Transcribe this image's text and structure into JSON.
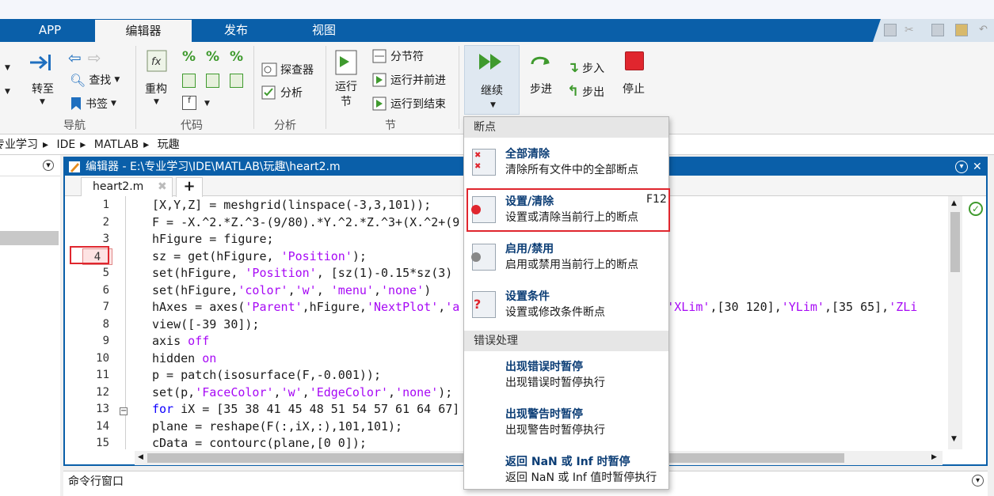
{
  "tabs": [
    "APP",
    "编辑器",
    "发布",
    "视图"
  ],
  "ribbon": {
    "nav": {
      "goto": "转至",
      "find": "查找",
      "bookmark": "书签",
      "group": "导航"
    },
    "code": {
      "refactor": "重构",
      "group": "代码"
    },
    "analyze": {
      "explorer": "探查器",
      "analyze": "分析",
      "group": "分析"
    },
    "section": {
      "run_section": "运行\n节",
      "section_break": "分节符",
      "run_and_advance": "运行并前进",
      "run_to_end": "运行到结束",
      "group": "节"
    },
    "debug": {
      "continue": "继续",
      "step": "步进",
      "step_in": "步入",
      "step_out": "步出",
      "stop": "停止"
    },
    "icons": {
      "percent": "%",
      "fx": "fx"
    }
  },
  "breadcrumb": [
    "专业学习",
    "IDE",
    "MATLAB",
    "玩趣"
  ],
  "editor": {
    "title": "编辑器 - E:\\专业学习\\IDE\\MATLAB\\玩趣\\heart2.m",
    "file_tab": "heart2.m",
    "add_tab": "+",
    "line_numbers": [
      "1",
      "2",
      "3",
      "4",
      "5",
      "6",
      "7",
      "8",
      "9",
      "10",
      "11",
      "12",
      "13",
      "14",
      "15"
    ],
    "code_lines": [
      [
        [
          "[X,Y,Z] = meshgrid(linspace(-3,3,101));",
          ""
        ]
      ],
      [
        [
          "F = -X.^2.*Z.^3-(9/80).*Y.^2.*Z.^3+(X.^2+(9",
          ""
        ]
      ],
      [
        [
          "hFigure = figure;",
          ""
        ]
      ],
      [
        [
          "sz = get(hFigure, ",
          ""
        ],
        [
          "'Position'",
          "s"
        ],
        [
          ");",
          ""
        ]
      ],
      [
        [
          "set(hFigure, ",
          ""
        ],
        [
          "'Position'",
          "s"
        ],
        [
          ", [sz(1)-0.15*sz(3)",
          ""
        ]
      ],
      [
        [
          "set(hFigure,",
          ""
        ],
        [
          "'color'",
          "s"
        ],
        [
          ",",
          ""
        ],
        [
          "'w'",
          "s"
        ],
        [
          ", ",
          ""
        ],
        [
          "'menu'",
          "s"
        ],
        [
          ",",
          ""
        ],
        [
          "'none'",
          "s"
        ],
        [
          ")",
          ""
        ]
      ],
      [
        [
          "hAxes = axes(",
          ""
        ],
        [
          "'Parent'",
          "s"
        ],
        [
          ",hFigure,",
          ""
        ],
        [
          "'NextPlot'",
          "s"
        ],
        [
          ",",
          ""
        ],
        [
          "'a",
          "s"
        ],
        [
          "                         1], ",
          ""
        ],
        [
          "'XLim'",
          "s"
        ],
        [
          ",[30 120],",
          ""
        ],
        [
          "'YLim'",
          "s"
        ],
        [
          ",[35 65],",
          ""
        ],
        [
          "'ZLi",
          "s"
        ]
      ],
      [
        [
          "view([-39 30]);",
          ""
        ]
      ],
      [
        [
          "axis ",
          ""
        ],
        [
          "off",
          "s"
        ]
      ],
      [
        [
          "hidden ",
          ""
        ],
        [
          "on",
          "s"
        ]
      ],
      [
        [
          "p = patch(isosurface(F,-0.001));",
          ""
        ]
      ],
      [
        [
          "set(p,",
          ""
        ],
        [
          "'FaceColor'",
          "s"
        ],
        [
          ",",
          ""
        ],
        [
          "'w'",
          "s"
        ],
        [
          ",",
          ""
        ],
        [
          "'EdgeColor'",
          "s"
        ],
        [
          ",",
          ""
        ],
        [
          "'none'",
          "s"
        ],
        [
          ");",
          ""
        ]
      ],
      [
        [
          "for",
          "k"
        ],
        [
          " iX = [35 38 41 45 48 51 54 57 61 64 67]",
          ""
        ]
      ],
      [
        [
          "plane = reshape(F(:,iX,:),101,101);",
          ""
        ]
      ],
      [
        [
          "cData = contourc(plane,[0 0]);",
          ""
        ]
      ]
    ],
    "breakpoint_line": "4"
  },
  "command_window": {
    "title": "命令行窗口"
  },
  "menu": {
    "header_breakpoints": "断点",
    "items": [
      {
        "title": "全部清除",
        "desc": "清除所有文件中的全部断点",
        "shortcut": ""
      },
      {
        "title": "设置/清除",
        "desc": "设置或清除当前行上的断点",
        "shortcut": "F12"
      },
      {
        "title": "启用/禁用",
        "desc": "启用或禁用当前行上的断点",
        "shortcut": ""
      },
      {
        "title": "设置条件",
        "desc": "设置或修改条件断点",
        "shortcut": ""
      }
    ],
    "header_errors": "错误处理",
    "error_items": [
      {
        "title": "出现错误时暂停",
        "desc": "出现错误时暂停执行"
      },
      {
        "title": "出现警告时暂停",
        "desc": "出现警告时暂停执行"
      },
      {
        "title": "返回 NaN 或 Inf 时暂停",
        "desc": "返回 NaN 或 Inf 值时暂停执行"
      }
    ]
  },
  "colors": {
    "accent": "#0a5fa9",
    "highlight": "#e0262e",
    "string": "#a709f5",
    "keyword": "#0e00ff"
  }
}
